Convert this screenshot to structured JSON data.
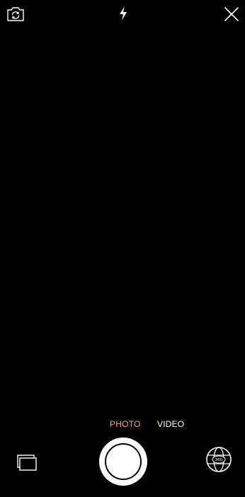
{
  "top_bar": {
    "flip_icon": "camera-flip-icon",
    "flash_icon": "flash-icon",
    "close_icon": "close-icon"
  },
  "modes": {
    "items": [
      "PHOTO",
      "VIDEO"
    ],
    "selected": "PHOTO"
  },
  "bottom_bar": {
    "gallery_icon": "gallery-icon",
    "shutter": "shutter-button",
    "ar_icon": "globe-360-icon",
    "ar_badge": "360"
  },
  "colors": {
    "background": "#000000",
    "accent": "#F5A77A",
    "foreground": "#FFFFFF"
  }
}
